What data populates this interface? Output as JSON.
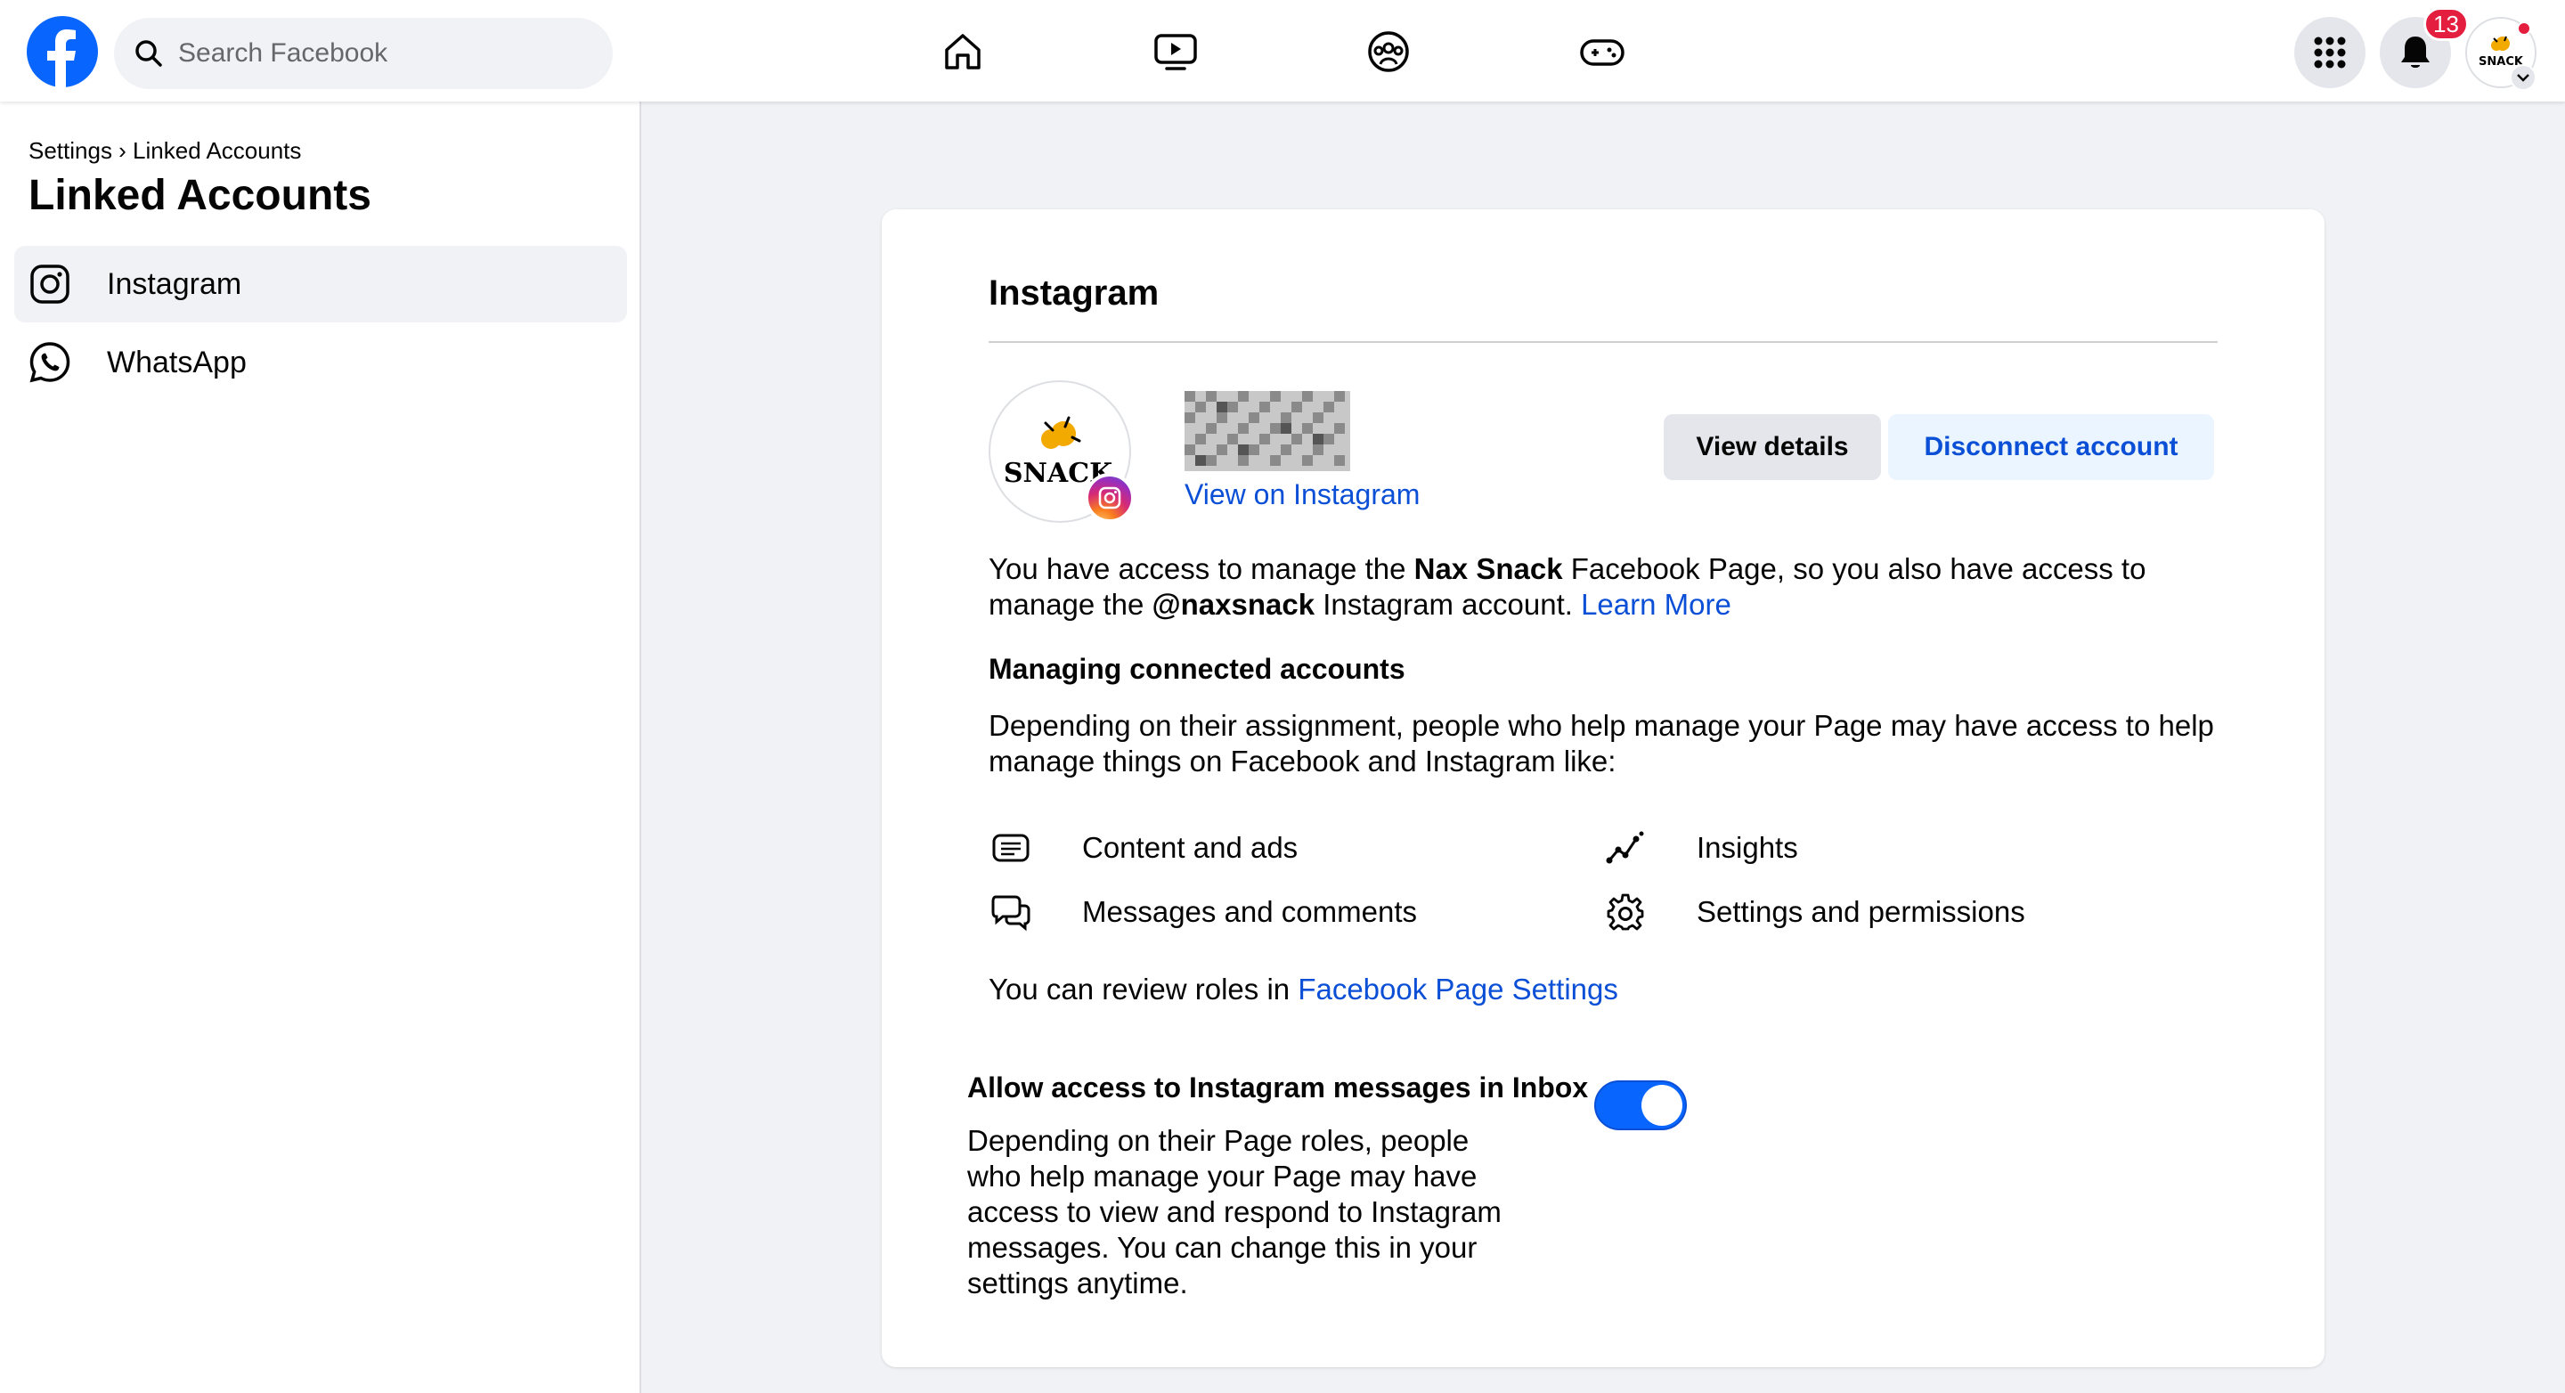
{
  "topbar": {
    "search_placeholder": "Search Facebook",
    "notification_count": "13",
    "icons": [
      "facebook-logo",
      "search-icon",
      "home-icon",
      "video-icon",
      "groups-icon",
      "gaming-icon",
      "menu-grid-icon",
      "bell-icon",
      "chevron-down-icon"
    ]
  },
  "sidebar": {
    "breadcrumb": "Settings › Linked Accounts",
    "title": "Linked Accounts",
    "items": [
      {
        "label": "Instagram",
        "icon": "instagram-icon",
        "active": true
      },
      {
        "label": "WhatsApp",
        "icon": "whatsapp-icon",
        "active": false
      }
    ]
  },
  "card": {
    "title": "Instagram",
    "avatar_text": "SNACK",
    "view_on_instagram": "View on Instagram",
    "view_details": "View details",
    "disconnect": "Disconnect account",
    "access": {
      "p1": "You have access to manage the ",
      "page_name": "Nax Snack",
      "p2": " Facebook Page, so you also have access to manage the ",
      "handle": "@naxsnack",
      "p3": " Instagram account. ",
      "learn_more": "Learn More"
    },
    "managing_title": "Managing connected accounts",
    "managing_desc": "Depending on their assignment, people who help manage your Page may have access to help manage things on Facebook and Instagram like:",
    "features": [
      {
        "label": "Content and ads",
        "icon": "content-icon"
      },
      {
        "label": "Insights",
        "icon": "insights-icon"
      },
      {
        "label": "Messages and comments",
        "icon": "messages-icon"
      },
      {
        "label": "Settings and permissions",
        "icon": "settings-icon"
      }
    ],
    "review": {
      "text": "You can review roles in ",
      "link": "Facebook Page Settings"
    },
    "toggle": {
      "title": "Allow access to Instagram messages in Inbox",
      "desc": "Depending on their Page roles, people who help manage your Page may have access to view and respond to Instagram messages. You can change this in your settings anytime.",
      "on": true
    }
  },
  "colors": {
    "brand": "#0866ff",
    "link": "#0a4fd6",
    "badge": "#e41e3f",
    "bg": "#f0f2f5"
  }
}
